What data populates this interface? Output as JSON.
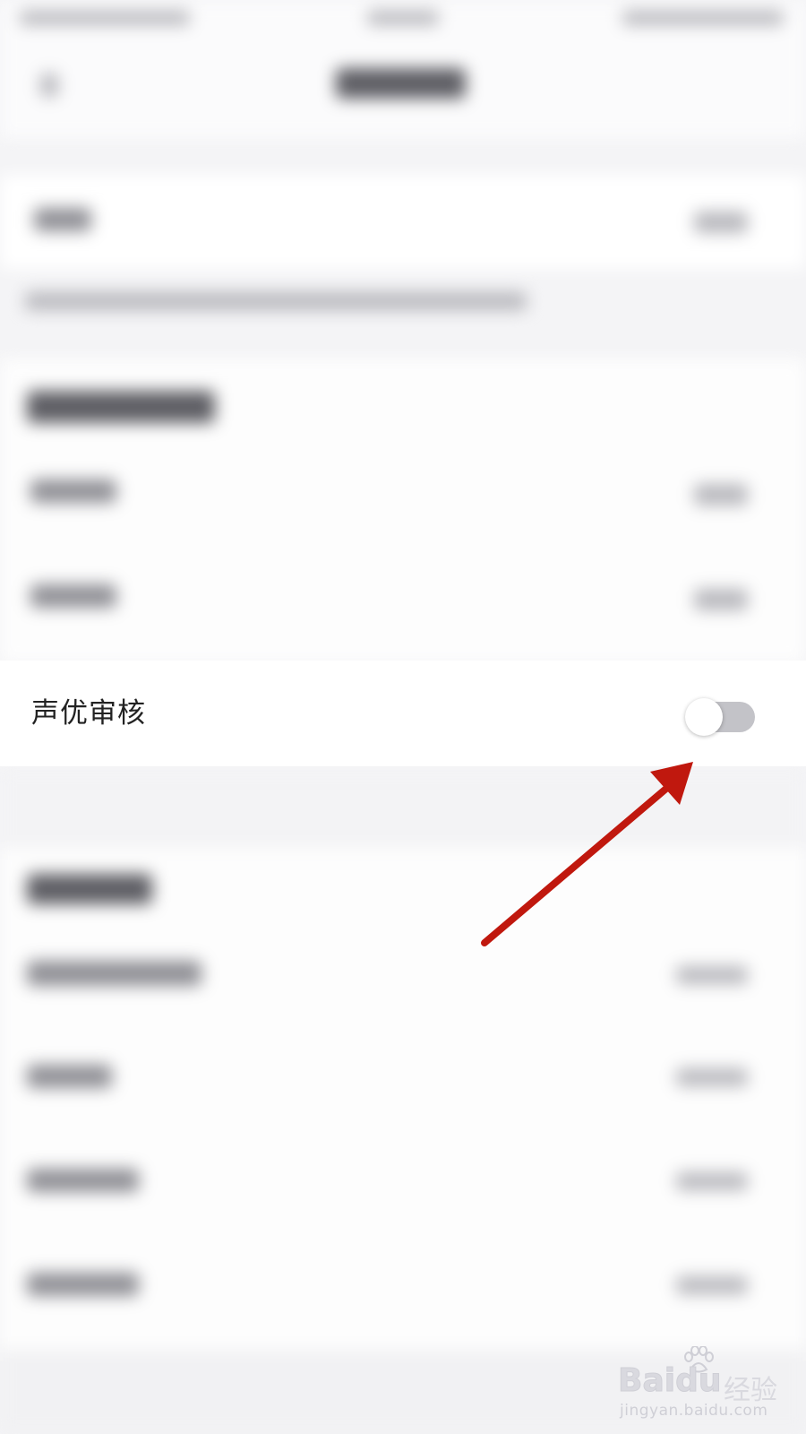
{
  "setting_row": {
    "label": "声优审核",
    "toggle_on": false
  },
  "annotation": {
    "arrow_color": "#c0180e"
  },
  "watermark": {
    "brand_latin": "Bai",
    "brand_latin_2": "du",
    "brand_cn": "经验",
    "url": "jingyan.baidu.com"
  },
  "colors": {
    "background": "#f4f4f6",
    "row_background": "#ffffff",
    "toggle_track_off": "#c3c3c8"
  }
}
